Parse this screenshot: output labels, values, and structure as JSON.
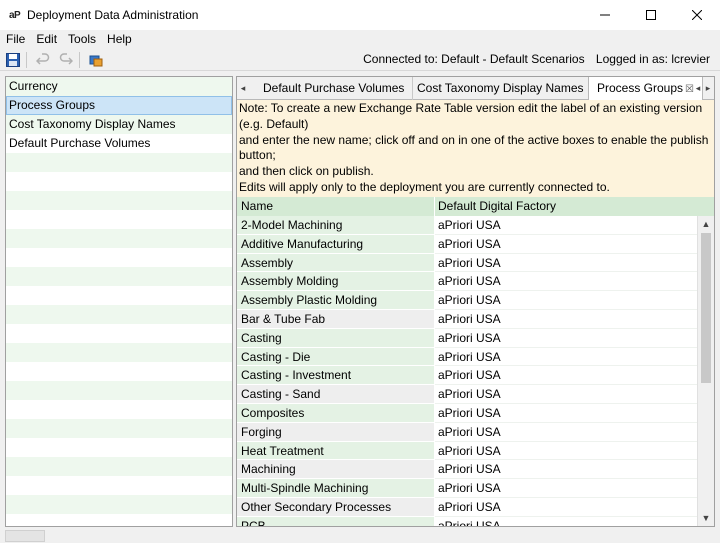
{
  "window": {
    "logo": "aP",
    "title": "Deployment Data Administration"
  },
  "menu": {
    "items": [
      "File",
      "Edit",
      "Tools",
      "Help"
    ]
  },
  "toolbar": {
    "icons": [
      "save-icon",
      "undo-icon",
      "redo-icon",
      "publish-icon"
    ]
  },
  "status": {
    "connected": "Connected to: Default - Default Scenarios",
    "logged_in": "Logged in as: lcrevier"
  },
  "left_list": {
    "items": [
      "Currency",
      "Process Groups",
      "Cost Taxonomy Display Names",
      "Default Purchase Volumes"
    ],
    "selected": "Process Groups"
  },
  "tabs": {
    "items": [
      "Default Purchase Volumes",
      "Cost Taxonomy Display Names",
      "Process Groups"
    ],
    "active": "Process Groups",
    "close_glyph": "☒"
  },
  "note": {
    "lines": [
      "Note: To create a new Exchange Rate Table version edit the label of an existing version (e.g. Default)",
      "and enter the new name; click off and on in one of the active boxes to enable the publish button;",
      "and then click on publish.",
      "Edits will apply only to the deployment you are currently connected to."
    ]
  },
  "grid": {
    "columns": [
      "Name",
      "Default Digital Factory"
    ],
    "rows": [
      [
        "2-Model Machining",
        "aPriori USA"
      ],
      [
        "Additive Manufacturing",
        "aPriori USA"
      ],
      [
        "Assembly",
        "aPriori USA"
      ],
      [
        "Assembly Molding",
        "aPriori USA"
      ],
      [
        "Assembly Plastic Molding",
        "aPriori USA"
      ],
      [
        "Bar & Tube Fab",
        "aPriori USA"
      ],
      [
        "Casting",
        "aPriori USA"
      ],
      [
        "Casting - Die",
        "aPriori USA"
      ],
      [
        "Casting - Investment",
        "aPriori USA"
      ],
      [
        "Casting - Sand",
        "aPriori USA"
      ],
      [
        "Composites",
        "aPriori USA"
      ],
      [
        "Forging",
        "aPriori USA"
      ],
      [
        "Heat Treatment",
        "aPriori USA"
      ],
      [
        "Machining",
        "aPriori USA"
      ],
      [
        "Multi-Spindle Machining",
        "aPriori USA"
      ],
      [
        "Other Secondary Processes",
        "aPriori USA"
      ],
      [
        "PCB",
        "aPriori USA"
      ]
    ]
  },
  "colors": {
    "list_odd_row": "#eef8ee",
    "selection": "#cce4f7",
    "note_background": "#fdf3dc",
    "grid_header": "#d4ead4"
  }
}
